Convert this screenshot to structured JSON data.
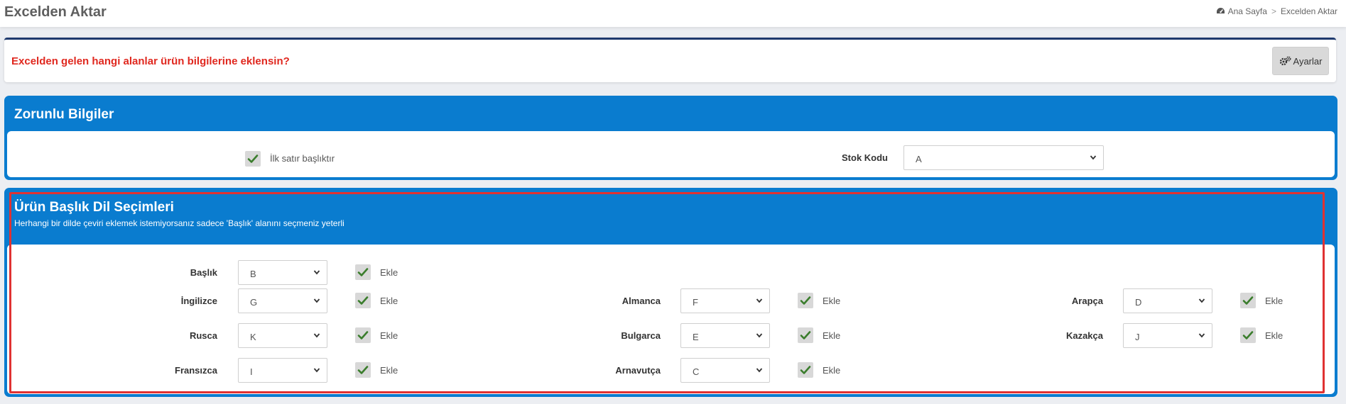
{
  "header": {
    "title": "Excelden Aktar",
    "breadcrumb": {
      "home": "Ana Sayfa",
      "separator": ">",
      "current": "Excelden Aktar"
    }
  },
  "question": {
    "text": "Excelden gelen hangi alanlar ürün bilgilerine eklensin?",
    "settings_label": "Ayarlar"
  },
  "required_panel": {
    "title": "Zorunlu Bilgiler",
    "first_row_checkbox": {
      "label": "İlk satır başlıktır",
      "checked": true
    },
    "stock_code": {
      "label": "Stok Kodu",
      "value": "A"
    }
  },
  "language_panel": {
    "title": "Ürün Başlık Dil Seçimleri",
    "subtitle": "Herhangi bir dilde çeviri eklemek istemiyorsanız sadece 'Başlık' alanını seçmeniz yeterli",
    "add_label": "Ekle",
    "fields": [
      {
        "label": "Başlık",
        "value": "B",
        "checked": true
      },
      {
        "label": "İngilizce",
        "value": "G",
        "checked": true
      },
      {
        "label": "Almanca",
        "value": "F",
        "checked": true
      },
      {
        "label": "Arapça",
        "value": "D",
        "checked": true
      },
      {
        "label": "Rusca",
        "value": "K",
        "checked": true
      },
      {
        "label": "Bulgarca",
        "value": "E",
        "checked": true
      },
      {
        "label": "Kazakça",
        "value": "J",
        "checked": true
      },
      {
        "label": "Fransızca",
        "value": "I",
        "checked": true
      },
      {
        "label": "Arnavutça",
        "value": "C",
        "checked": true
      }
    ]
  },
  "colors": {
    "panel_blue": "#0a7ccf",
    "question_red": "#e0281f",
    "highlight_red": "#e03232",
    "check_green": "#3a7d2c"
  },
  "icons": {
    "breadcrumb_home": "dashboard-icon",
    "settings": "gears-icon",
    "checkbox": "check-icon",
    "select": "chevron-down-icon"
  }
}
